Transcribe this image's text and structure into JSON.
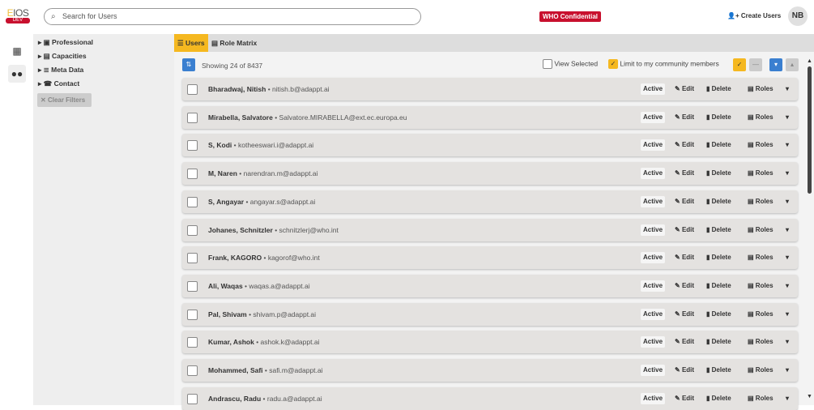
{
  "header": {
    "logo_main": "EIOS",
    "logo_env": "DEV",
    "search_placeholder": "Search for Users",
    "confidential": "WHO Confidential",
    "create_users": "Create Users",
    "avatar": "NB"
  },
  "filters": {
    "items": [
      "Professional",
      "Capacities",
      "Meta Data",
      "Contact"
    ],
    "clear": "Clear Filters"
  },
  "tabs": [
    {
      "label": "Users",
      "active": true
    },
    {
      "label": "Role Matrix",
      "active": false
    }
  ],
  "toolbar": {
    "showing": "Showing 24 of 8437",
    "view_selected": "View Selected",
    "view_selected_checked": false,
    "limit": "Limit to my community members",
    "limit_checked": true
  },
  "row_actions": {
    "status": "Active",
    "edit": "Edit",
    "delete": "Delete",
    "roles": "Roles"
  },
  "users": [
    {
      "name": "Bharadwaj, Nitish",
      "email": "nitish.b@adappt.ai"
    },
    {
      "name": "Mirabella, Salvatore",
      "email": "Salvatore.MIRABELLA@ext.ec.europa.eu"
    },
    {
      "name": "S, Kodi",
      "email": "kotheeswari.i@adappt.ai"
    },
    {
      "name": "M, Naren",
      "email": "narendran.m@adappt.ai"
    },
    {
      "name": "S, Angayar",
      "email": "angayar.s@adappt.ai"
    },
    {
      "name": "Johanes, Schnitzler",
      "email": "schnitzlerj@who.int"
    },
    {
      "name": "Frank, KAGORO",
      "email": "kagorof@who.int"
    },
    {
      "name": "Ali, Waqas",
      "email": "waqas.a@adappt.ai"
    },
    {
      "name": "Pal, Shivam",
      "email": "shivam.p@adappt.ai"
    },
    {
      "name": "Kumar, Ashok",
      "email": "ashok.k@adappt.ai"
    },
    {
      "name": "Mohammed, Safi",
      "email": "safi.m@adappt.ai"
    },
    {
      "name": "Andrascu, Radu",
      "email": "radu.a@adappt.ai"
    }
  ]
}
